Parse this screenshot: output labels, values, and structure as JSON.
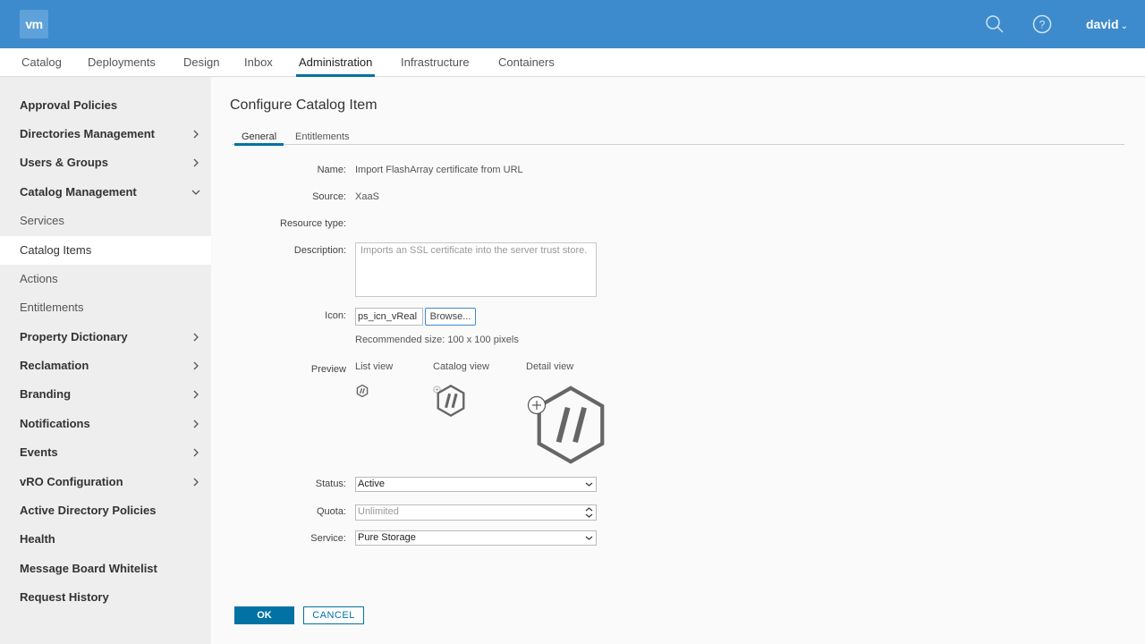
{
  "header": {
    "logo": "vm",
    "user": "david",
    "user_caret": "⌄",
    "icons": [
      "search-icon",
      "help-icon"
    ],
    "bg_color": "#3d8bcd"
  },
  "topnav": {
    "tabs": [
      {
        "label": "Catalog"
      },
      {
        "label": "Deployments"
      },
      {
        "label": "Design"
      },
      {
        "label": "Inbox"
      },
      {
        "label": "Administration",
        "active": true
      },
      {
        "label": "Infrastructure"
      },
      {
        "label": "Containers"
      }
    ]
  },
  "sidebar": {
    "items": [
      {
        "label": "Approval Policies"
      },
      {
        "label": "Directories Management",
        "chevron": "right"
      },
      {
        "label": "Users & Groups",
        "chevron": "right"
      },
      {
        "label": "Catalog Management",
        "chevron": "down"
      },
      {
        "label": "Services"
      },
      {
        "label": "Catalog Items",
        "active": true
      },
      {
        "label": "Actions"
      },
      {
        "label": "Entitlements"
      },
      {
        "label": "Property Dictionary",
        "chevron": "right"
      },
      {
        "label": "Reclamation",
        "chevron": "right"
      },
      {
        "label": "Branding",
        "chevron": "right"
      },
      {
        "label": "Notifications",
        "chevron": "right"
      },
      {
        "label": "Events",
        "chevron": "right"
      },
      {
        "label": "vRO Configuration",
        "chevron": "right"
      },
      {
        "label": "Active Directory Policies"
      },
      {
        "label": "Health"
      },
      {
        "label": "Message Board Whitelist"
      },
      {
        "label": "Request History"
      }
    ]
  },
  "main": {
    "title": "Configure Catalog Item",
    "tabs": [
      {
        "label": "General",
        "active": true
      },
      {
        "label": "Entitlements"
      }
    ],
    "form": {
      "name_label": "Name:",
      "name_value": "Import FlashArray certificate from URL",
      "source_label": "Source:",
      "source_value": "XaaS",
      "resource_type_label": "Resource type:",
      "description_label": "Description:",
      "description_value": "Imports an SSL certificate into the server trust store.",
      "icon_label": "Icon:",
      "icon_value": "ps_icn_vReal",
      "browse_label": "Browse...",
      "recommended": "Recommended size: 100 x 100 pixels",
      "preview_label": "Preview",
      "preview_list": "List view",
      "preview_catalog": "Catalog view",
      "preview_detail": "Detail view",
      "status_label": "Status:",
      "status_value": "Active",
      "quota_label": "Quota:",
      "quota_placeholder": "Unlimited",
      "service_label": "Service:",
      "service_value": "Pure Storage"
    },
    "buttons": {
      "ok": "OK",
      "cancel": "CANCEL"
    }
  }
}
